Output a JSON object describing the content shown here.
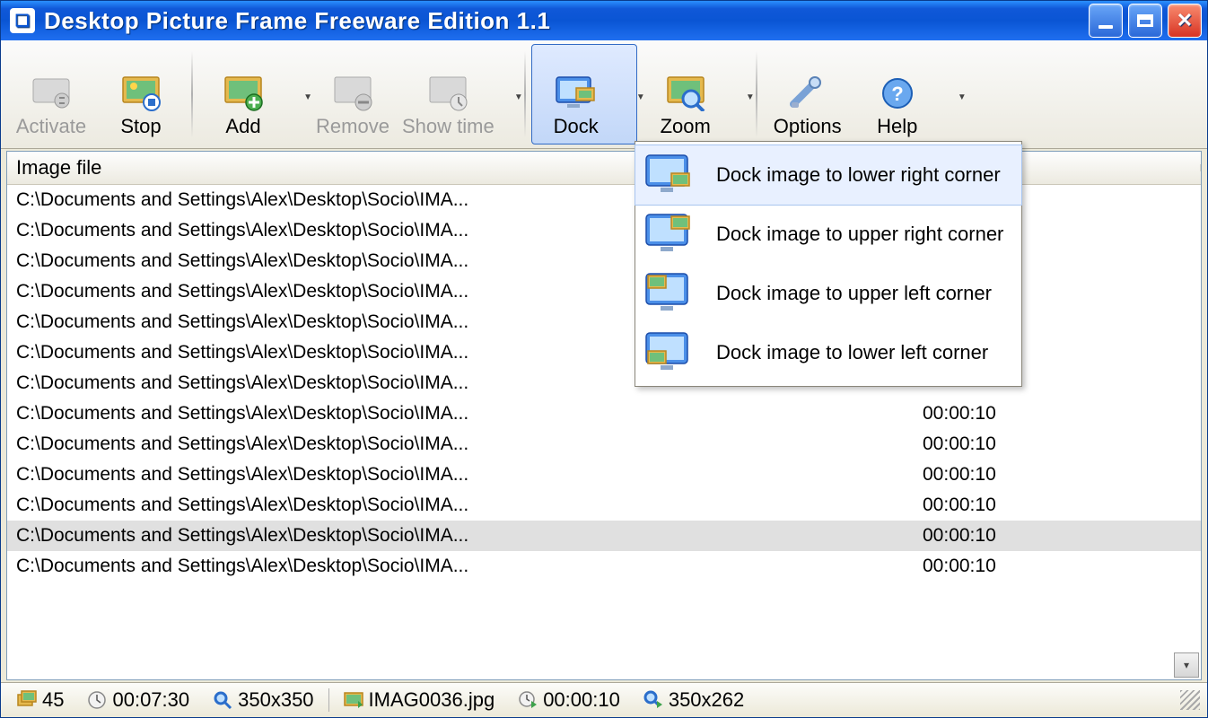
{
  "window": {
    "title": "Desktop Picture Frame Freeware Edition 1.1"
  },
  "toolbar": {
    "activate": "Activate",
    "stop": "Stop",
    "add": "Add",
    "remove": "Remove",
    "showtime": "Show time",
    "dock": "Dock",
    "zoom": "Zoom",
    "options": "Options",
    "help": "Help"
  },
  "list": {
    "header_file": "Image file",
    "header_time": "",
    "rows": [
      {
        "file": "C:\\Documents and Settings\\Alex\\Desktop\\Socio\\IMA...",
        "time": ""
      },
      {
        "file": "C:\\Documents and Settings\\Alex\\Desktop\\Socio\\IMA...",
        "time": ""
      },
      {
        "file": "C:\\Documents and Settings\\Alex\\Desktop\\Socio\\IMA...",
        "time": ""
      },
      {
        "file": "C:\\Documents and Settings\\Alex\\Desktop\\Socio\\IMA...",
        "time": ""
      },
      {
        "file": "C:\\Documents and Settings\\Alex\\Desktop\\Socio\\IMA...",
        "time": ""
      },
      {
        "file": "C:\\Documents and Settings\\Alex\\Desktop\\Socio\\IMA...",
        "time": ""
      },
      {
        "file": "C:\\Documents and Settings\\Alex\\Desktop\\Socio\\IMA...",
        "time": ""
      },
      {
        "file": "C:\\Documents and Settings\\Alex\\Desktop\\Socio\\IMA...",
        "time": "00:00:10"
      },
      {
        "file": "C:\\Documents and Settings\\Alex\\Desktop\\Socio\\IMA...",
        "time": "00:00:10"
      },
      {
        "file": "C:\\Documents and Settings\\Alex\\Desktop\\Socio\\IMA...",
        "time": "00:00:10"
      },
      {
        "file": "C:\\Documents and Settings\\Alex\\Desktop\\Socio\\IMA...",
        "time": "00:00:10"
      },
      {
        "file": "C:\\Documents and Settings\\Alex\\Desktop\\Socio\\IMA...",
        "time": "00:00:10",
        "selected": true
      },
      {
        "file": "C:\\Documents and Settings\\Alex\\Desktop\\Socio\\IMA...",
        "time": "00:00:10"
      }
    ]
  },
  "dock_menu": {
    "items": [
      {
        "label": "Dock image to lower right corner",
        "hovered": true
      },
      {
        "label": "Dock image to upper right corner"
      },
      {
        "label": "Dock image to upper left corner"
      },
      {
        "label": "Dock image to lower left corner"
      }
    ]
  },
  "status": {
    "count": "45",
    "total_time": "00:07:30",
    "thumb_size": "350x350",
    "current_file": "IMAG0036.jpg",
    "current_time": "00:00:10",
    "current_size": "350x262"
  }
}
